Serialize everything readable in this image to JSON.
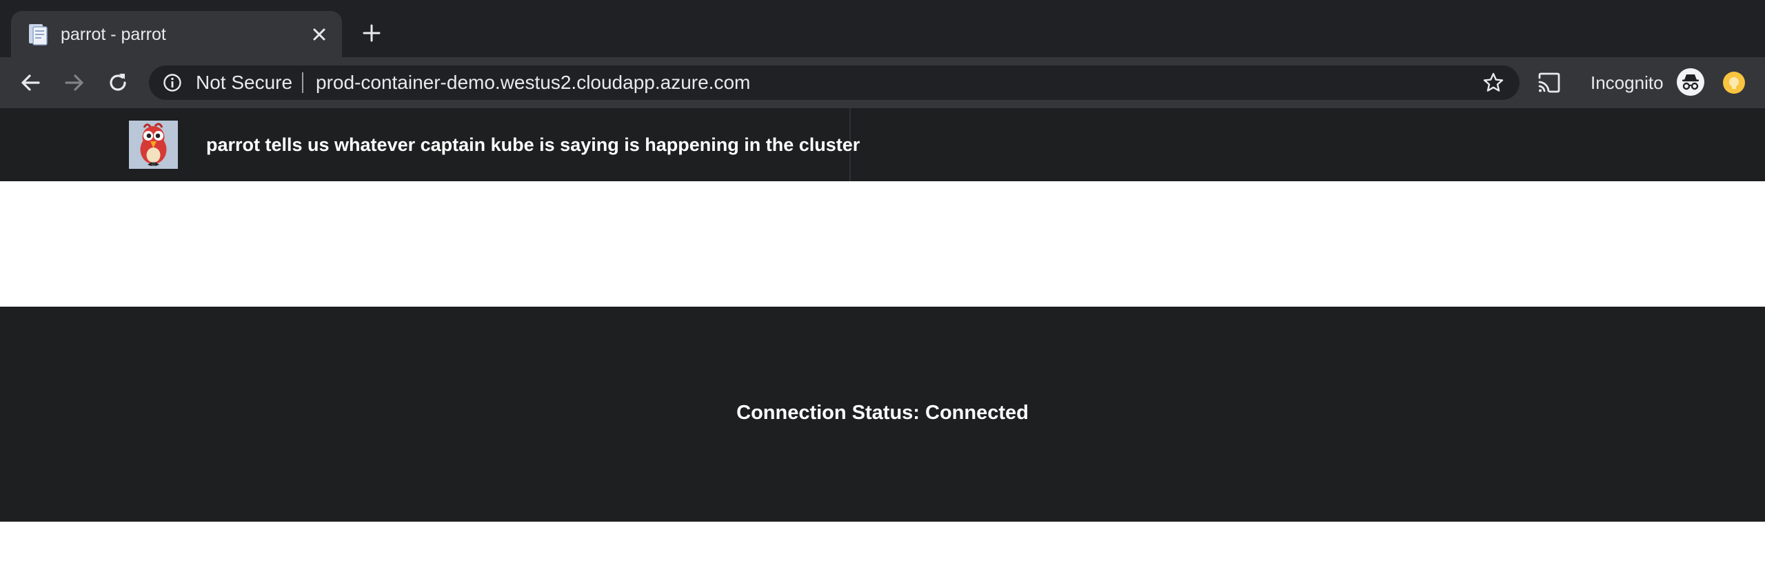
{
  "browser": {
    "tab": {
      "title": "parrot - parrot",
      "favicon": "document-icon"
    },
    "new_tab_icon": "plus-icon",
    "nav": {
      "back_icon": "back-arrow-icon",
      "forward_icon": "forward-arrow-icon",
      "reload_icon": "reload-icon"
    },
    "omnibox": {
      "security_label": "Not Secure",
      "url": "prod-container-demo.westus2.cloudapp.azure.com",
      "bookmark_icon": "star-icon"
    },
    "cast_icon": "cast-icon",
    "profile_label": "Incognito",
    "extension_icon": "extension-icon"
  },
  "page": {
    "header": {
      "logo": "parrot-logo",
      "tagline": "parrot tells us whatever captain kube is saying is happening in the cluster"
    },
    "status": {
      "text": "Connection Status: Connected"
    }
  },
  "colors": {
    "tabbar_bg": "#202124",
    "toolbar_bg": "#35363a",
    "omnibox_bg": "#202124",
    "page_header_bg": "#1e1f21",
    "status_panel_bg": "#1e1f21",
    "extension_accent": "#f9c440"
  }
}
